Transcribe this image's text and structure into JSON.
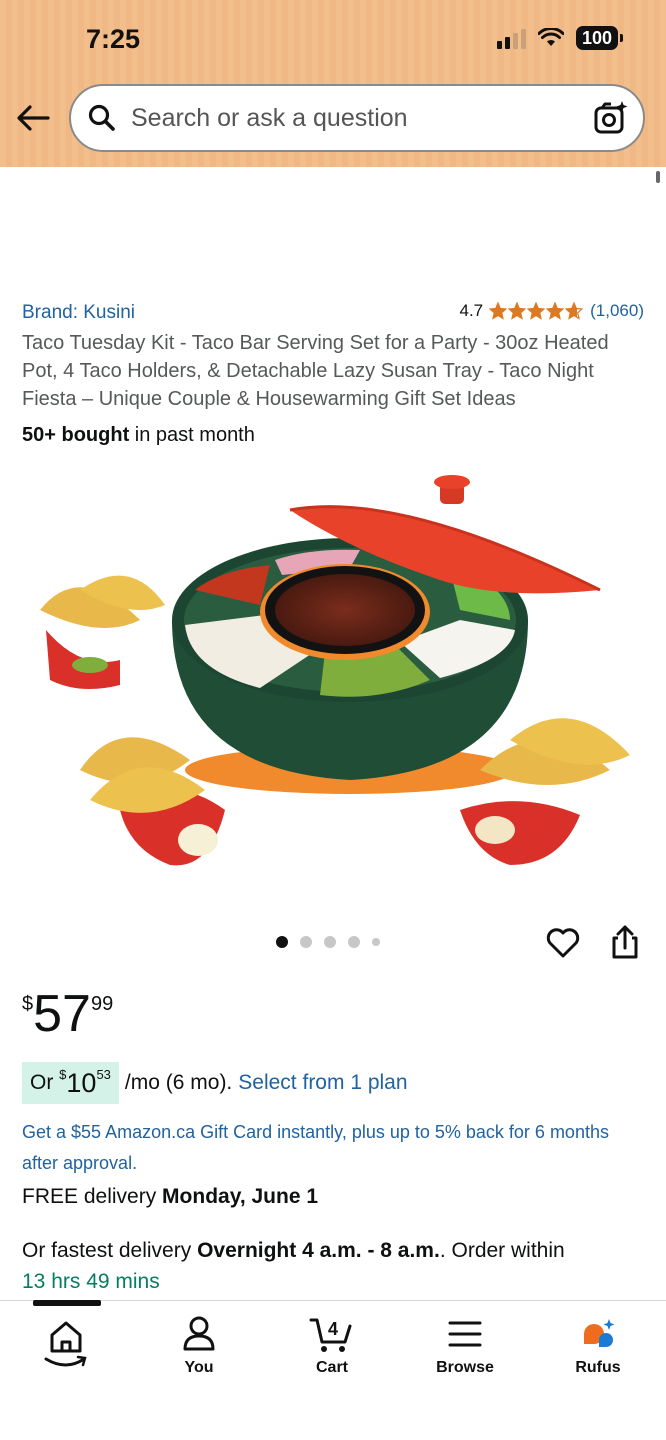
{
  "status_bar": {
    "time": "7:25",
    "battery": "100"
  },
  "search": {
    "placeholder": "Search or ask a question"
  },
  "product": {
    "brand": "Brand: Kusini",
    "rating": "4.7",
    "stars_value": 4.7,
    "review_count": "(1,060)",
    "title": "Taco Tuesday Kit - Taco Bar Serving Set for a Party - 30oz Heated Pot, 4 Taco Holders, & Detachable Lazy Susan Tray - Taco Night Fiesta – Unique Couple & Housewarming Gift Set Ideas",
    "bought_bold": "50+ bought",
    "bought_rest": "in past month",
    "image_count": 5,
    "image_index": 1
  },
  "price": {
    "currency": "$",
    "whole": "57",
    "fraction": "99"
  },
  "installment": {
    "prefix": "Or",
    "currency": "$",
    "whole": "10",
    "fraction": "53",
    "term": "/mo (6 mo).",
    "link": "Select from 1 plan"
  },
  "giftcard": "Get a $55 Amazon.ca Gift Card instantly, plus up to 5% back for 6 months after approval.",
  "delivery": {
    "prefix": "FREE delivery",
    "date": "Monday, June 1"
  },
  "fastest": {
    "prefix": "Or fastest delivery",
    "window": "Overnight 4 a.m. - 8 a.m.",
    "middle": ". Order within",
    "countdown": "13 hrs 49 mins"
  },
  "nav": {
    "home": "",
    "you": "You",
    "cart": "Cart",
    "cart_count": "4",
    "browse": "Browse",
    "rufus": "Rufus"
  },
  "colors": {
    "accent_link": "#2162a1",
    "star": "#de7921",
    "header_bg": "#f2be8c",
    "green": "#067d62"
  }
}
